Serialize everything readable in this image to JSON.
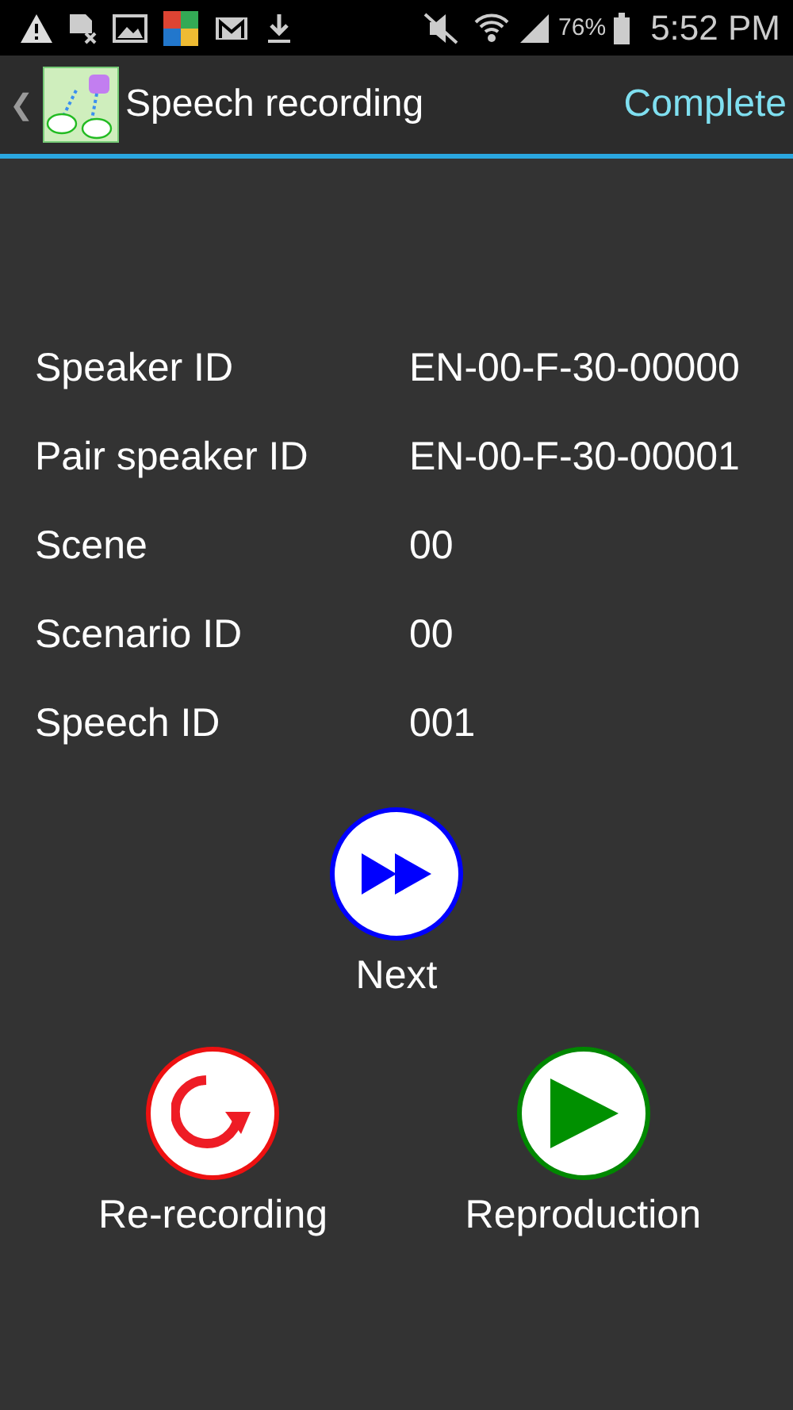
{
  "status_bar": {
    "battery": "76%",
    "time": "5:52 PM"
  },
  "action_bar": {
    "back": "❮",
    "title": "Speech recording",
    "action": "Complete"
  },
  "fields": [
    {
      "label": "Speaker ID",
      "value": "EN-00-F-30-00000"
    },
    {
      "label": "Pair speaker ID",
      "value": "EN-00-F-30-00001"
    },
    {
      "label": "Scene",
      "value": "00"
    },
    {
      "label": "Scenario ID",
      "value": "00"
    },
    {
      "label": "Speech ID",
      "value": "001"
    }
  ],
  "next_button": {
    "kind": "next",
    "label": "Next"
  },
  "buttons": [
    {
      "kind": "rerecord",
      "label": "Re-recording"
    },
    {
      "kind": "play",
      "label": "Reproduction"
    }
  ]
}
